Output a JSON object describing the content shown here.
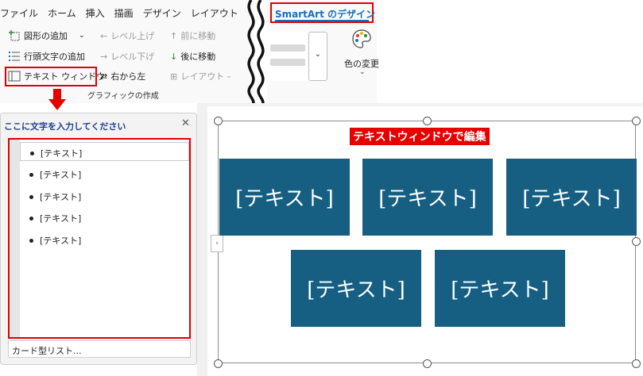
{
  "ribbon": {
    "tabs": [
      "ファイル",
      "ホーム",
      "挿入",
      "描画",
      "デザイン",
      "レイアウト"
    ],
    "commands": {
      "add_shape": "図形の追加",
      "add_bullet": "行頭文字の追加",
      "text_pane": "テキスト ウィンドウ",
      "promote": "レベル上げ",
      "demote": "レベル下げ",
      "right_to_left": "右から左",
      "move_up": "前に移動",
      "move_down": "後に移動",
      "layout": "レイアウト"
    },
    "group_label": "グラフィックの作成",
    "design_tab": "SmartArt のデザイン",
    "change_colors": "色の変更"
  },
  "text_pane": {
    "title": "ここに文字を入力してください",
    "close_glyph": "✕",
    "items": [
      "[テキスト]",
      "[テキスト]",
      "[テキスト]",
      "[テキスト]",
      "[テキスト]"
    ],
    "footer": "カード型リスト..."
  },
  "canvas": {
    "callout_label": "テキストウィンドウで編集",
    "boxes": [
      "[テキスト]",
      "[テキスト]",
      "[テキスト]",
      "[テキスト]",
      "[テキスト]"
    ]
  },
  "colors": {
    "accent_red": "#e60000",
    "box_fill": "#165f83",
    "tab_blue": "#1b6fb8"
  }
}
